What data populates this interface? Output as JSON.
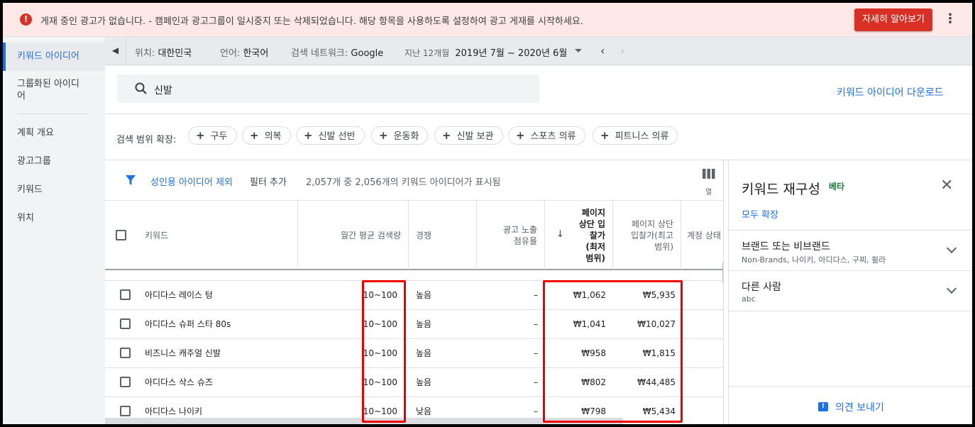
{
  "banner": {
    "message": "게재 중인 광고가 없습니다. - 캠페인과 광고그룹이 일시중지 또는 삭제되었습니다. 해당 항목을 사용하도록 설정하여 광고 게재를 시작하세요.",
    "learn_more": "자세히 알아보기",
    "more_icon": "⋮"
  },
  "nav": {
    "items": [
      "키워드 아이디어",
      "그룹화된 아이디어",
      "계획 개요",
      "광고그룹",
      "키워드",
      "위치"
    ],
    "active_index": 0
  },
  "topbar": {
    "location_label": "위치:",
    "location_value": "대한민국",
    "language_label": "언어:",
    "language_value": "한국어",
    "network_label": "검색 네트워크:",
    "network_value": "Google",
    "period_label": "지난 12개월",
    "period_value": "2019년 7월 ~ 2020년 6월"
  },
  "search": {
    "value": "신발"
  },
  "download_label": "키워드 아이디어 다운로드",
  "expand": {
    "label": "검색 범위 확장:",
    "chips": [
      "구두",
      "의복",
      "신발 선반",
      "운동화",
      "신발 보관",
      "스포츠 의류",
      "피트니스 의류"
    ]
  },
  "filters": {
    "exclude_adult": "성인용 아이디어 제외",
    "add_filter": "필터 추가",
    "count_text": "2,057개 중 2,056개의 키워드 아이디어가 표시됨",
    "columns_label": "열"
  },
  "table": {
    "headers": {
      "keyword": "키워드",
      "monthly": "월간 평균 검색량",
      "competition": "경쟁",
      "impression_share": "광고 노출 점유율",
      "bid_low": "페이지 상단 입찰가 (최저 범위)",
      "bid_high": "페이지 상단 입찰가(최고 범위)",
      "account_status": "계정 상태"
    },
    "rows": [
      {
        "keyword": "아디다스 레이스 텅",
        "monthly": "10~100",
        "competition": "높음",
        "impression_share": "–",
        "bid_low": "₩1,062",
        "bid_high": "₩5,935"
      },
      {
        "keyword": "아디다스 슈퍼 스타 80s",
        "monthly": "10~100",
        "competition": "높음",
        "impression_share": "–",
        "bid_low": "₩1,041",
        "bid_high": "₩10,027"
      },
      {
        "keyword": "비즈니스 캐주얼 신발",
        "monthly": "10~100",
        "competition": "높음",
        "impression_share": "–",
        "bid_low": "₩958",
        "bid_high": "₩1,815"
      },
      {
        "keyword": "아디다스 삭스 슈즈",
        "monthly": "10~100",
        "competition": "높음",
        "impression_share": "–",
        "bid_low": "₩802",
        "bid_high": "₩44,485"
      },
      {
        "keyword": "아디다스 나이키",
        "monthly": "10~100",
        "competition": "낮음",
        "impression_share": "–",
        "bid_low": "₩798",
        "bid_high": "₩5,434"
      }
    ]
  },
  "panel": {
    "title": "키워드 재구성",
    "beta": "베타",
    "expand_all": "모두 확장",
    "sections": [
      {
        "title": "브랜드 또는 비브랜드",
        "subtitle": "Non-Brands, 나이키, 아디다스, 구찌, 휠라"
      },
      {
        "title": "다른 사람",
        "subtitle": "abc"
      }
    ],
    "feedback": "의견 보내기"
  },
  "colors": {
    "accent": "#1a73e8",
    "error": "#d93025",
    "highlight": "#ee0000"
  }
}
